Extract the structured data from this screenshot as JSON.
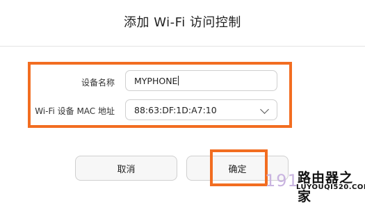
{
  "dialog": {
    "title": "添加 Wi-Fi 访问控制"
  },
  "form": {
    "device_name_label": "设备名称",
    "device_name_value": "MYPHONE",
    "mac_label": "Wi-Fi 设备 MAC 地址",
    "mac_value": "88:63:DF:1D:A7:10"
  },
  "buttons": {
    "cancel_label": "取消",
    "confirm_label": "确定"
  },
  "watermark": {
    "number": "191",
    "logo_text": "路由器之家",
    "url": "LUYOUQI520.COM"
  },
  "colors": {
    "highlight": "#f26d21"
  }
}
